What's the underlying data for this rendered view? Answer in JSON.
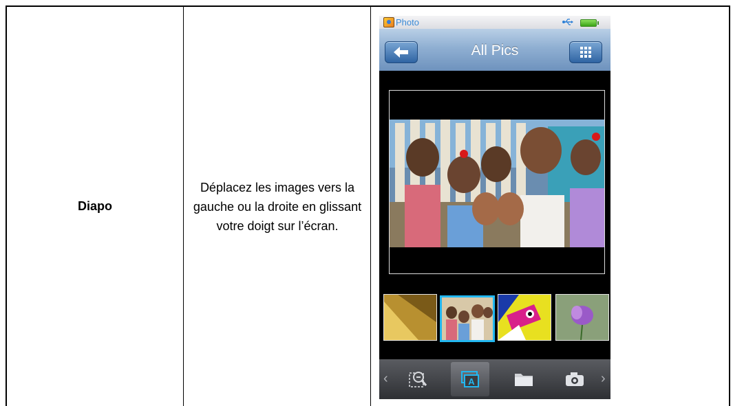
{
  "table": {
    "feature_name": "Diapo",
    "description": "Déplacez les images vers la gauche ou la droite en glissant votre doigt sur l’écran."
  },
  "device_screen": {
    "status_bar": {
      "app_label": "Photo",
      "app_icon": "photo-app-icon",
      "usb_icon": "usb-icon",
      "battery_icon": "battery-icon"
    },
    "title_bar": {
      "title": "All Pics",
      "left_button_icon": "back-arrow-icon",
      "right_button_icon": "grid-icon"
    },
    "photo_viewer": {
      "main_image": "children-waving-photo"
    },
    "thumbnails": [
      {
        "image": "golden-texture-thumbnail",
        "selected": false
      },
      {
        "image": "children-photo-thumbnail",
        "selected": true
      },
      {
        "image": "colorful-bird-thumbnail",
        "selected": false
      },
      {
        "image": "purple-flower-thumbnail",
        "selected": false
      }
    ],
    "toolbar": {
      "left_arrow": "‹",
      "right_arrow": "›",
      "items": [
        {
          "icon": "zoom-icon",
          "active": false
        },
        {
          "icon": "slideshow-icon",
          "active": true
        },
        {
          "icon": "folder-icon",
          "active": false
        },
        {
          "icon": "camera-icon",
          "active": false
        }
      ]
    },
    "colors": {
      "accent": "#22b7f0",
      "titlebar": "#8fafd2",
      "toolbar": "#3a3c40"
    }
  }
}
